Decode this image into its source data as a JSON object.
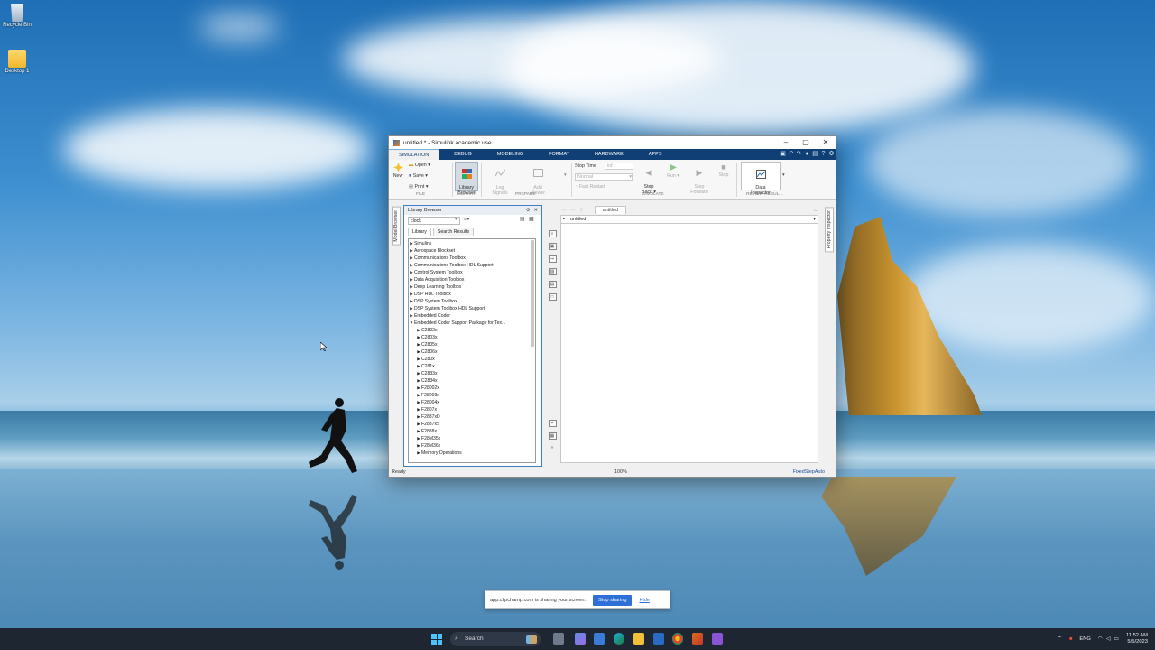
{
  "desktop": {
    "icons": [
      {
        "label": "Recycle Bin"
      },
      {
        "label": "Desktop 1"
      }
    ]
  },
  "window": {
    "title": "untitled * - Simulink academic use",
    "tabs": [
      "SIMULATION",
      "DEBUG",
      "MODELING",
      "FORMAT",
      "HARDWARE",
      "APPS"
    ],
    "ribbon": {
      "new": "New",
      "open": "Open",
      "save": "Save",
      "print": "Print",
      "file_section": "FILE",
      "library_browser": "Library\nBrowser",
      "library_section": "LIBRARY",
      "log_signals": "Log\nSignals",
      "add_viewer": "Add\nViewer",
      "prepare_section": "PREPARE",
      "stop_time_label": "Stop Time",
      "stop_time_value": "inf",
      "mode_value": "Normal",
      "fast_restart": "Fast Restart",
      "step_back": "Step\nBack",
      "run": "Run",
      "step_forward": "Step\nForward",
      "stop": "Stop",
      "simulate_section": "SIMULATE",
      "data_inspector": "Data\nInspector",
      "review_section": "REVIEW RESUL..."
    },
    "side_tabs": {
      "left": "Model Browser",
      "right": "Property Inspector"
    },
    "library_browser": {
      "title": "Library Browser",
      "search_value": "clock",
      "tabs": [
        "Library",
        "Search Results"
      ],
      "tree": [
        {
          "label": "Simulink",
          "level": 0,
          "expanded": false
        },
        {
          "label": "Aerospace Blockset",
          "level": 0,
          "expanded": false
        },
        {
          "label": "Communications Toolbox",
          "level": 0,
          "expanded": false
        },
        {
          "label": "Communications Toolbox HDL Support",
          "level": 0,
          "expanded": false
        },
        {
          "label": "Control System Toolbox",
          "level": 0,
          "expanded": false
        },
        {
          "label": "Data Acquisition Toolbox",
          "level": 0,
          "expanded": false
        },
        {
          "label": "Deep Learning Toolbox",
          "level": 0,
          "expanded": false
        },
        {
          "label": "DSP HDL Toolbox",
          "level": 0,
          "expanded": false
        },
        {
          "label": "DSP System Toolbox",
          "level": 0,
          "expanded": false
        },
        {
          "label": "DSP System Toolbox HDL Support",
          "level": 0,
          "expanded": false
        },
        {
          "label": "Embedded Coder",
          "level": 0,
          "expanded": false
        },
        {
          "label": "Embedded Coder Support Package for Tex...",
          "level": 0,
          "expanded": true
        },
        {
          "label": "C2802x",
          "level": 1,
          "expanded": false
        },
        {
          "label": "C2803x",
          "level": 1,
          "expanded": false
        },
        {
          "label": "C2805x",
          "level": 1,
          "expanded": false
        },
        {
          "label": "C2806x",
          "level": 1,
          "expanded": false
        },
        {
          "label": "C280x",
          "level": 1,
          "expanded": false
        },
        {
          "label": "C281x",
          "level": 1,
          "expanded": false
        },
        {
          "label": "C2833x",
          "level": 1,
          "expanded": false
        },
        {
          "label": "C2834x",
          "level": 1,
          "expanded": false
        },
        {
          "label": "F28002x",
          "level": 1,
          "expanded": false
        },
        {
          "label": "F28003x",
          "level": 1,
          "expanded": false
        },
        {
          "label": "F28004x",
          "level": 1,
          "expanded": false
        },
        {
          "label": "F2807x",
          "level": 1,
          "expanded": false
        },
        {
          "label": "F2837xD",
          "level": 1,
          "expanded": false
        },
        {
          "label": "F2837xS",
          "level": 1,
          "expanded": false
        },
        {
          "label": "F2838x",
          "level": 1,
          "expanded": false
        },
        {
          "label": "F28M35x",
          "level": 1,
          "expanded": false
        },
        {
          "label": "F28M36x",
          "level": 1,
          "expanded": false
        },
        {
          "label": "Memory Operations",
          "level": 1,
          "expanded": false
        }
      ]
    },
    "canvas": {
      "tab": "untitled",
      "path": "untitled"
    },
    "status": {
      "left": "Ready",
      "zoom": "100%",
      "solver": "FixedStepAuto"
    }
  },
  "share_banner": {
    "message": "app.clipchamp.com is sharing your screen.",
    "stop_label": "Stop sharing",
    "hide_label": "Hide"
  },
  "taskbar": {
    "search_placeholder": "Search",
    "language": "ENG",
    "time": "11:52 AM",
    "date": "5/5/2023"
  }
}
